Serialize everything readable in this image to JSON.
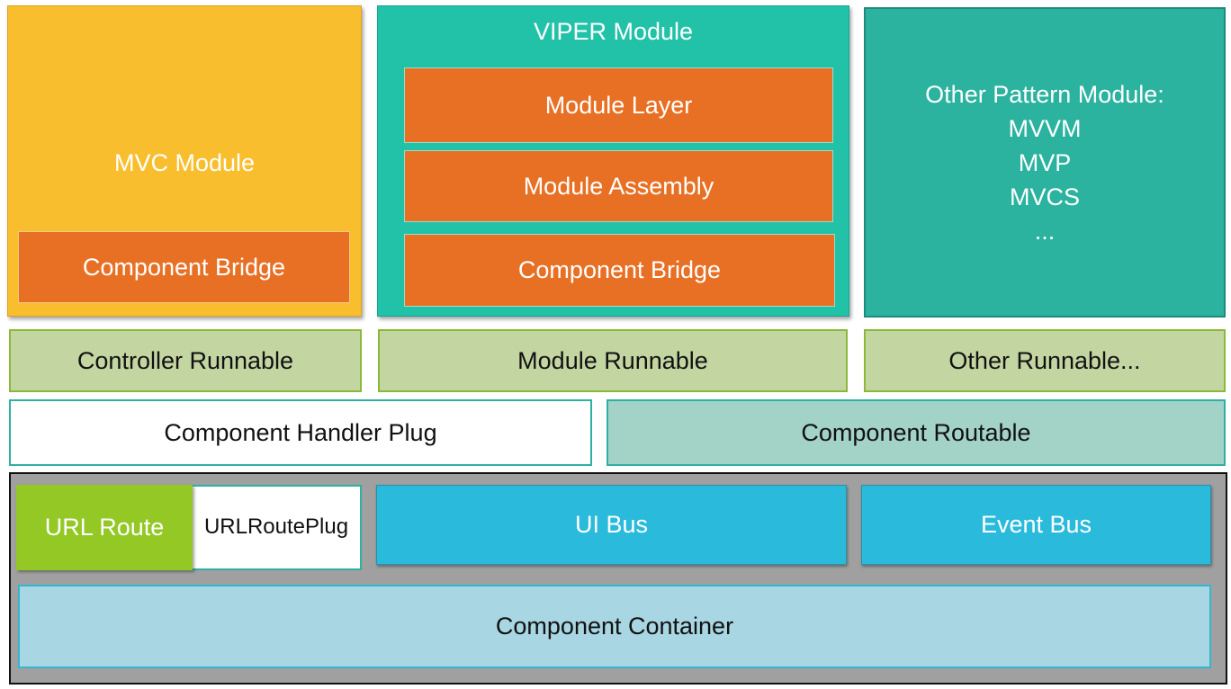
{
  "modules": {
    "mvc": {
      "title": "MVC Module",
      "bridge": "Component Bridge"
    },
    "viper": {
      "title": "VIPER Module",
      "layers": [
        "Module Layer",
        "Module Assembly",
        "Component Bridge"
      ]
    },
    "other": {
      "lines": [
        "Other Pattern Module:",
        "MVVM",
        "MVP",
        "MVCS",
        "..."
      ]
    }
  },
  "runnables": [
    "Controller Runnable",
    "Module Runnable",
    "Other Runnable..."
  ],
  "middle": {
    "handler_plug": "Component Handler Plug",
    "routable": "Component Routable"
  },
  "base": {
    "url_route": "URL Route",
    "url_route_plug": "URLRoutePlug",
    "ui_bus": "UI Bus",
    "event_bus": "Event Bus",
    "container": "Component Container"
  },
  "colors": {
    "mvc": "#f9be2d",
    "orange": "#e87024",
    "viper": "#21c2a8",
    "other": "#2bb3a0",
    "runnable": "#c3d6a2",
    "routable": "#a3d2c7",
    "base": "#a0a0a0",
    "url_route": "#93c825",
    "bus": "#2abbdc",
    "container": "#a8d6e2"
  }
}
